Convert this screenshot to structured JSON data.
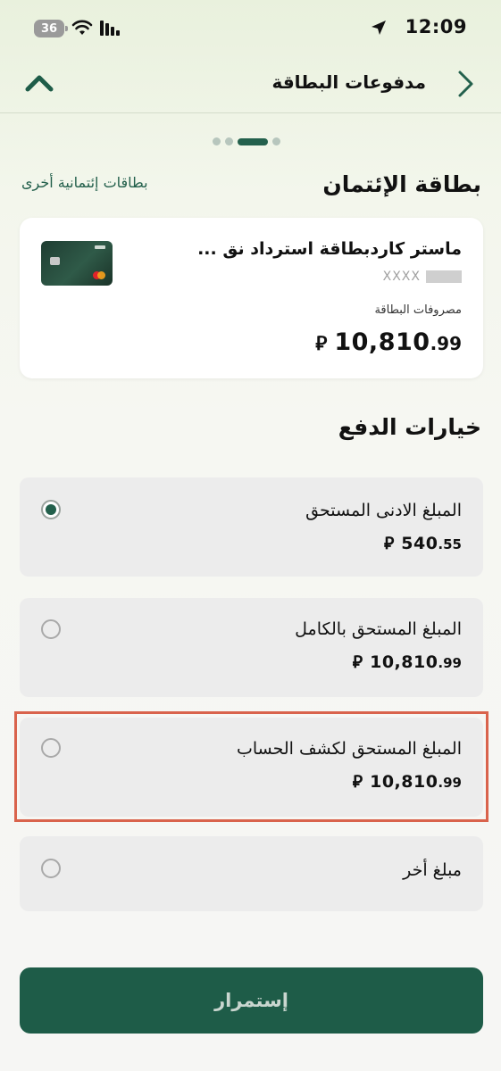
{
  "status_bar": {
    "time": "12:09",
    "battery": "36"
  },
  "header": {
    "title": "مدفوعات البطاقة"
  },
  "credit_card_section": {
    "title": "بطاقة الإئتمان",
    "other_cards_link": "بطاقات إئتمانية أخرى",
    "card": {
      "name": "ماستر كاردبطاقة استرداد نق ...",
      "masked_number": "XXXX",
      "spend_label": "مصروفات البطاقة",
      "amount_int": "10,810",
      "amount_dec": ".99",
      "currency": "⃁"
    }
  },
  "payment_options": {
    "title": "خيارات الدفع",
    "options": [
      {
        "label": "المبلغ الادنى المستحق",
        "amount_int": "540",
        "amount_dec": ".55",
        "currency": "⃁",
        "selected": true
      },
      {
        "label": "المبلغ المستحق بالكامل",
        "amount_int": "10,810",
        "amount_dec": ".99",
        "currency": "⃁",
        "selected": false
      },
      {
        "label": "المبلغ المستحق لكشف الحساب",
        "amount_int": "10,810",
        "amount_dec": ".99",
        "currency": "⃁",
        "selected": false
      },
      {
        "label": "مبلغ أخر",
        "selected": false
      }
    ]
  },
  "continue_button": {
    "label": "إستمرار"
  },
  "colors": {
    "primary": "#1e5c48",
    "accent": "#23604c",
    "highlight": "#d9634c"
  }
}
